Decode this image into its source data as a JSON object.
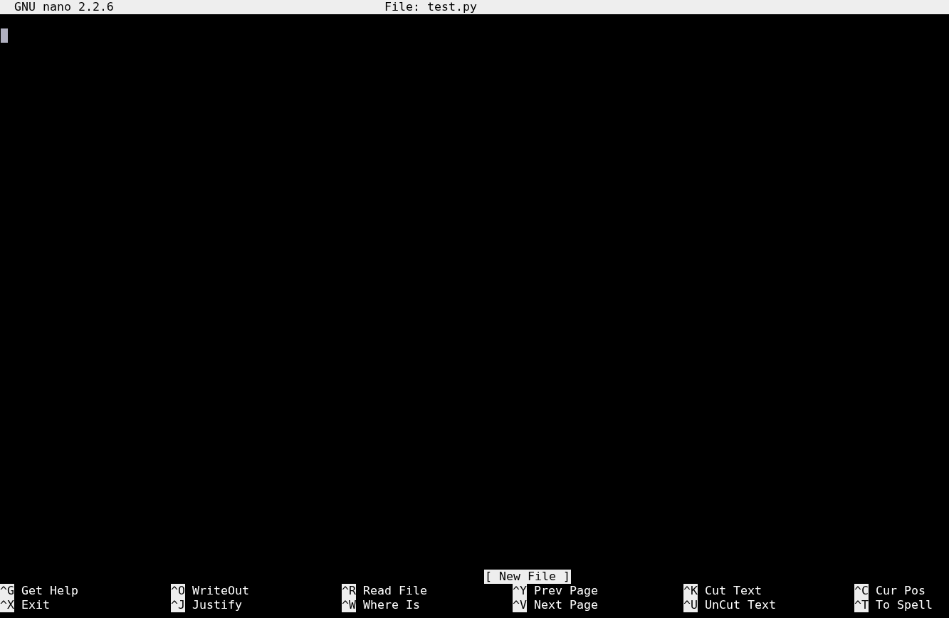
{
  "title_bar": {
    "program": "GNU nano 2.2.6",
    "file": "File: test.py"
  },
  "status_message": "[ New File ]",
  "shortcut_rows": [
    [
      {
        "key": "^G",
        "label": "Get Help"
      },
      {
        "key": "^O",
        "label": "WriteOut"
      },
      {
        "key": "^R",
        "label": "Read File"
      },
      {
        "key": "^Y",
        "label": "Prev Page"
      },
      {
        "key": "^K",
        "label": "Cut Text"
      },
      {
        "key": "^C",
        "label": "Cur Pos"
      }
    ],
    [
      {
        "key": "^X",
        "label": "Exit"
      },
      {
        "key": "^J",
        "label": "Justify"
      },
      {
        "key": "^W",
        "label": "Where Is"
      },
      {
        "key": "^V",
        "label": "Next Page"
      },
      {
        "key": "^U",
        "label": "UnCut Text"
      },
      {
        "key": "^T",
        "label": "To Spell"
      }
    ]
  ]
}
